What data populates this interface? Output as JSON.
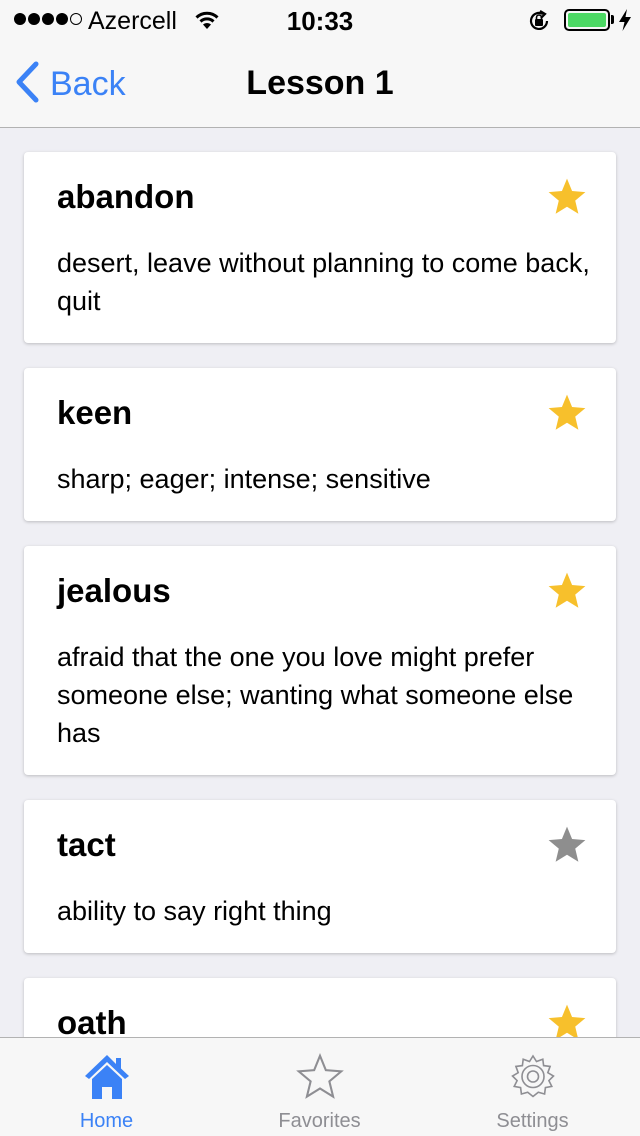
{
  "status_bar": {
    "carrier": "Azercell",
    "time": "10:33"
  },
  "nav": {
    "back_label": "Back",
    "title": "Lesson 1"
  },
  "words": [
    {
      "word": "abandon",
      "definition": "desert, leave without planning to come back, quit",
      "favorite": true
    },
    {
      "word": "keen",
      "definition": "sharp; eager; intense; sensitive",
      "favorite": true
    },
    {
      "word": "jealous",
      "definition": "afraid that the one you love might prefer someone else; wanting what someone else has",
      "favorite": true
    },
    {
      "word": "tact",
      "definition": "ability to say right thing",
      "favorite": false
    },
    {
      "word": "oath",
      "definition": "",
      "favorite": true
    }
  ],
  "tabs": [
    {
      "label": "Home",
      "icon": "home-icon",
      "active": true
    },
    {
      "label": "Favorites",
      "icon": "star-outline-icon",
      "active": false
    },
    {
      "label": "Settings",
      "icon": "gear-icon",
      "active": false
    }
  ],
  "colors": {
    "accent": "#3b82f6",
    "star_active": "#f7c02c",
    "star_inactive": "#8e8e8e",
    "battery": "#4cd964"
  }
}
